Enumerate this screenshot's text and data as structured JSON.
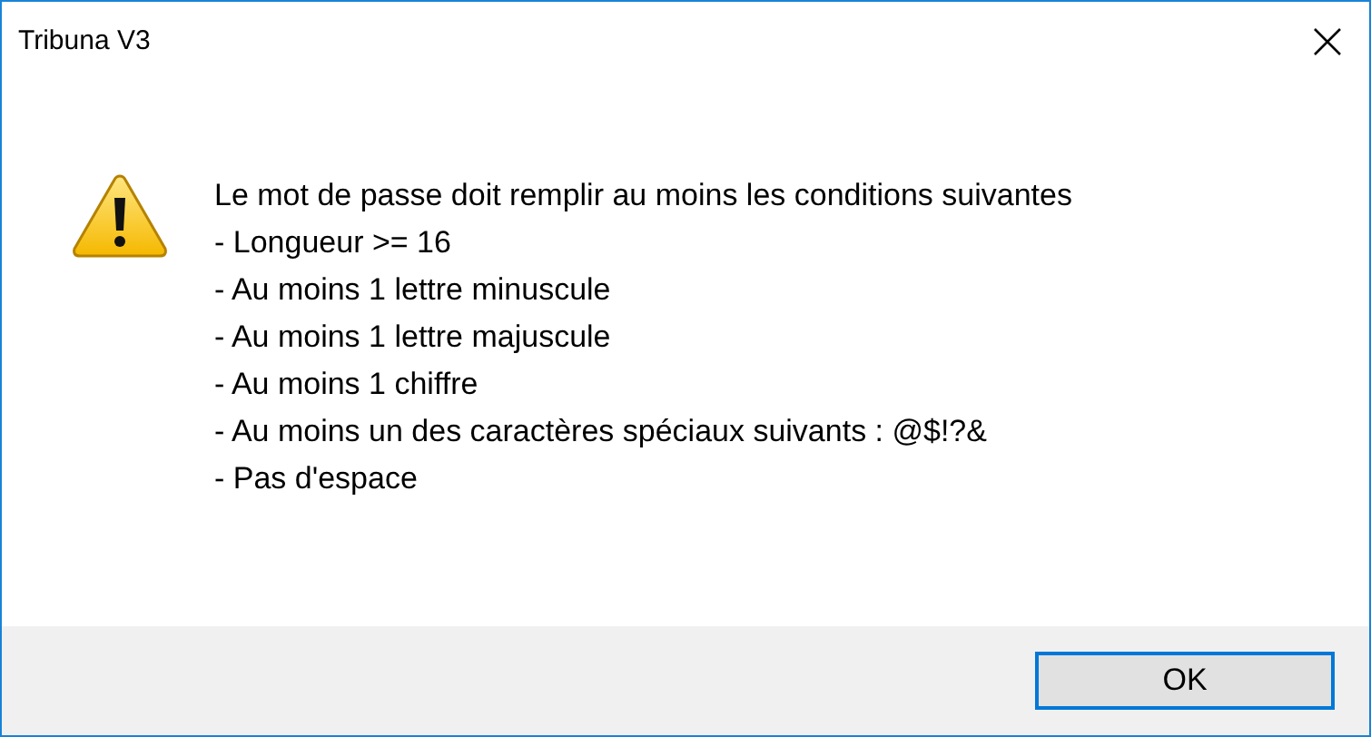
{
  "window": {
    "title": "Tribuna V3"
  },
  "message": {
    "lines": [
      "Le mot de passe doit remplir au moins les conditions suivantes",
      "- Longueur >= 16",
      "- Au moins 1 lettre minuscule",
      "- Au moins 1 lettre majuscule",
      "- Au moins 1 chiffre",
      "- Au moins un des caractères spéciaux suivants : @$!?&",
      "- Pas d'espace"
    ]
  },
  "buttons": [
    {
      "label": "OK",
      "selected": true
    }
  ]
}
